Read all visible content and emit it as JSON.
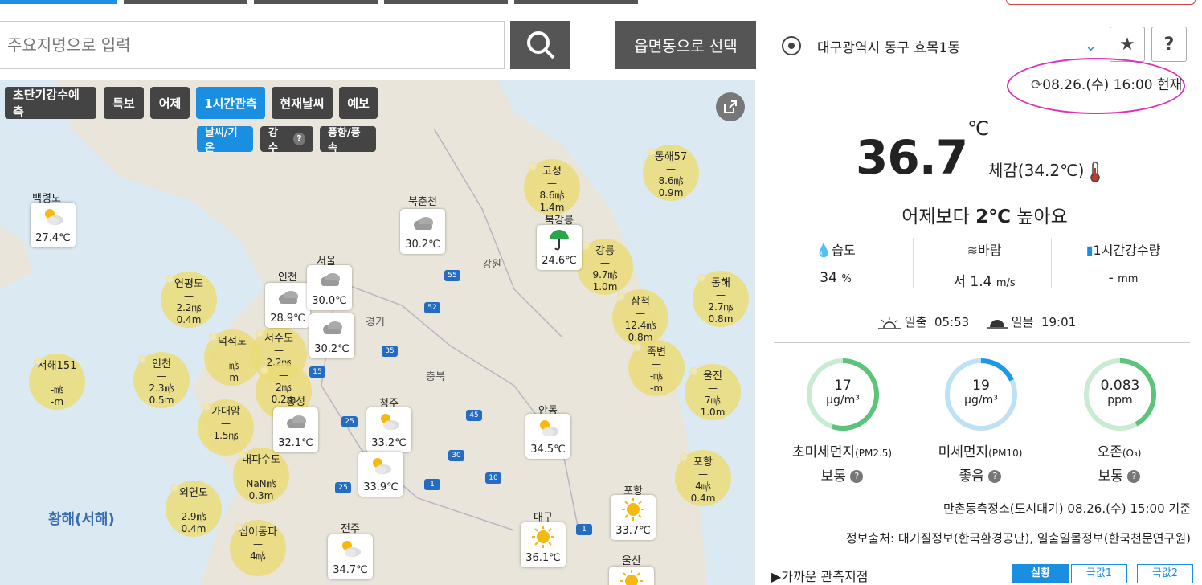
{
  "top_tabs": [
    "",
    "",
    "",
    "",
    ""
  ],
  "search": {
    "placeholder": "주요지명으로 입력",
    "town_button": "읍면동으로 선택"
  },
  "map": {
    "chips_row1": [
      "초단기강수예측",
      "특보",
      "어제",
      "1시간관측",
      "현재날씨",
      "예보"
    ],
    "chips_row2": [
      "날씨/기온",
      "강수",
      "풍향/풍속"
    ],
    "sea_label": "황해(서해)",
    "province_labels": [
      "강원",
      "경기",
      "충북"
    ],
    "bubbles": [
      {
        "name": "동해57",
        "wind": "8.6㎧",
        "wave": "0.9m"
      },
      {
        "name": "고성",
        "wind": "8.6㎧",
        "wave": "1.4m"
      },
      {
        "name": "강릉",
        "wind": "9.7㎧",
        "wave": "1.0m"
      },
      {
        "name": "동해",
        "wind": "2.7㎧",
        "wave": "0.8m"
      },
      {
        "name": "삼척",
        "wind": "12.4㎧",
        "wave": "0.8m"
      },
      {
        "name": "죽변",
        "wind": "-㎧",
        "wave": "-m"
      },
      {
        "name": "울진",
        "wind": "7㎧",
        "wave": "1.0m"
      },
      {
        "name": "포항",
        "wind": "4㎧",
        "wave": "0.4m"
      },
      {
        "name": "연평도",
        "wind": "2.2㎧",
        "wave": "0.4m"
      },
      {
        "name": "덕적도",
        "wind": "-㎧",
        "wave": "-m"
      },
      {
        "name": "서수도",
        "wind": "2.2㎧",
        "wave": ""
      },
      {
        "name": "",
        "wind": "2㎧",
        "wave": "0.2m"
      },
      {
        "name": "인천",
        "wind": "2.3㎧",
        "wave": "0.5m"
      },
      {
        "name": "서해151",
        "wind": "-㎧",
        "wave": "-m"
      },
      {
        "name": "가대암",
        "wind": "1.5㎧",
        "wave": ""
      },
      {
        "name": "내파수도",
        "wind": "NaN㎧",
        "wave": "0.3m"
      },
      {
        "name": "외연도",
        "wind": "2.9㎧",
        "wave": "0.4m"
      },
      {
        "name": "십이동파",
        "wind": "4㎧",
        "wave": ""
      }
    ],
    "stations": [
      {
        "name": "백령도",
        "temp": "27.4℃",
        "icon": "partly-cloudy"
      },
      {
        "name": "북춘천",
        "temp": "30.2℃",
        "icon": "cloudy"
      },
      {
        "name": "북강릉",
        "temp": "24.6℃",
        "icon": "umbrella"
      },
      {
        "name": "인천",
        "temp": "28.9℃",
        "icon": "cloudy"
      },
      {
        "name": "서울",
        "temp": "30.0℃",
        "icon": "cloudy"
      },
      {
        "name": "",
        "temp": "30.2℃",
        "icon": "cloudy"
      },
      {
        "name": "홍성",
        "temp": "32.1℃",
        "icon": "cloudy"
      },
      {
        "name": "청주",
        "temp": "33.2℃",
        "icon": "partly-cloudy"
      },
      {
        "name": "",
        "temp": "33.9℃",
        "icon": "partly-cloudy"
      },
      {
        "name": "안동",
        "temp": "34.5℃",
        "icon": "partly-cloudy"
      },
      {
        "name": "포항",
        "temp": "33.7℃",
        "icon": "sunny"
      },
      {
        "name": "대구",
        "temp": "36.1℃",
        "icon": "sunny"
      },
      {
        "name": "전주",
        "temp": "34.7℃",
        "icon": "partly-cloudy"
      },
      {
        "name": "울산",
        "temp": "",
        "icon": "sunny"
      }
    ]
  },
  "panel": {
    "location": "대구광역시 동구 효목1동",
    "star_icon": "★",
    "help_icon": "?",
    "updated": "08.26.(수) 16:00 현재",
    "temp": "36.7",
    "temp_unit": "℃",
    "feels": "체감(34.2℃)",
    "compare_pre": "어제보다 ",
    "compare_val": "2℃",
    "compare_post": " 높아요",
    "humidity_label": "습도",
    "humidity_val": "34",
    "humidity_unit": "%",
    "wind_label": "바람",
    "wind_val": "서 1.4",
    "wind_unit": "m/s",
    "rain_label": "1시간강수량",
    "rain_val": "-",
    "rain_unit": "mm",
    "sunrise_label": "일출",
    "sunrise": "05:53",
    "sunset_label": "일몰",
    "sunset": "19:01",
    "gauges": [
      {
        "value": "17",
        "unit": "μg/m³",
        "label": "초미세먼지",
        "sub": "(PM2.5)",
        "state": "보통",
        "level": 0.55,
        "color": "#5cc47a"
      },
      {
        "value": "19",
        "unit": "μg/m³",
        "label": "미세먼지",
        "sub": "(PM10)",
        "state": "좋음",
        "level": 0.18,
        "color": "#1a9ae8"
      },
      {
        "value": "0.083",
        "unit": "ppm",
        "label": "오존",
        "sub": "(O₃)",
        "state": "보통",
        "level": 0.42,
        "color": "#5cc47a"
      }
    ],
    "station_note": "만촌동측정소(도시대기) 08.26.(수) 15:00 기준",
    "source_note": "정보출처: 대기질정보(한국환경공단), 일출일몰정보(한국천문연구원)",
    "nearby": "▶가까운 관측지점",
    "tabs": [
      "실황",
      "극값1",
      "극값2"
    ]
  }
}
